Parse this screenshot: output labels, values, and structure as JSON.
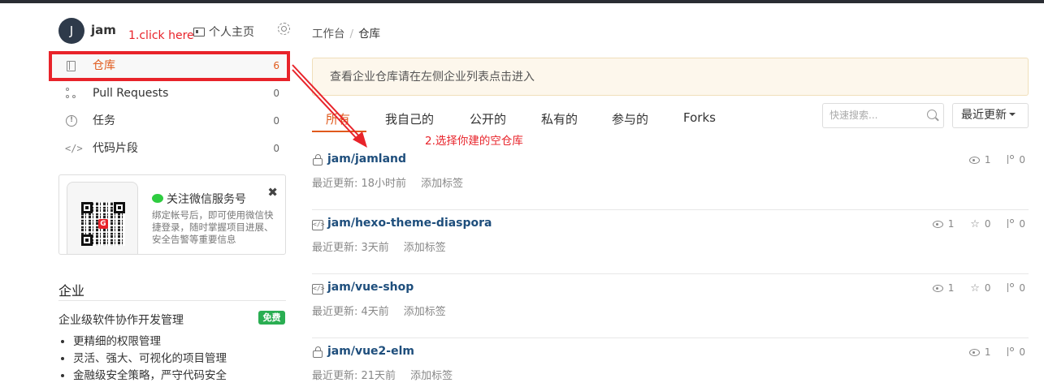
{
  "user": {
    "avatar_letter": "J",
    "name": "jam",
    "profile_link": "个人主页"
  },
  "annotations": {
    "step1": "1.click here",
    "step2": "2.选择你建的空仓库"
  },
  "nav": [
    {
      "label": "仓库",
      "count": "6",
      "icon": "book-icon",
      "active": true
    },
    {
      "label": "Pull Requests",
      "count": "0",
      "icon": "pull-request-icon"
    },
    {
      "label": "任务",
      "count": "0",
      "icon": "task-icon"
    },
    {
      "label": "代码片段",
      "count": "0",
      "icon": "code-snippet-icon"
    }
  ],
  "wechat": {
    "title": "关注微信服务号",
    "desc": "绑定帐号后，即可使用微信快捷登录，随时掌握项目进展、安全告警等重要信息",
    "close": "✖",
    "qr_logo": "G"
  },
  "enterprise": {
    "title": "企业",
    "subtitle": "企业级软件协作开发管理",
    "badge": "免费",
    "features": [
      "更精细的权限管理",
      "灵活、强大、可视化的项目管理",
      "金融级安全策略，严守代码安全"
    ]
  },
  "breadcrumb": {
    "root": "工作台",
    "sep": "/",
    "current": "仓库"
  },
  "notice": "查看企业仓库请在左侧企业列表点击进入",
  "tabs": [
    "所有",
    "我自己的",
    "公开的",
    "私有的",
    "参与的",
    "Forks"
  ],
  "active_tab": "所有",
  "search": {
    "placeholder": "快速搜索..."
  },
  "sort": {
    "label": "最近更新"
  },
  "repos": [
    {
      "name": "jam/jamland",
      "icon": "lock-icon",
      "updated": "最近更新: 18小时前",
      "tag_action": "添加标签",
      "watch": "1",
      "star": null,
      "fork": "0"
    },
    {
      "name": "jam/hexo-theme-diaspora",
      "icon": "code-repo-icon",
      "updated": "最近更新: 3天前",
      "tag_action": "添加标签",
      "watch": "1",
      "star": "0",
      "fork": "0"
    },
    {
      "name": "jam/vue-shop",
      "icon": "code-repo-icon",
      "updated": "最近更新: 4天前",
      "tag_action": "添加标签",
      "watch": "1",
      "star": "0",
      "fork": "0"
    },
    {
      "name": "jam/vue2-elm",
      "icon": "lock-icon",
      "updated": "最近更新: 21天前",
      "tag_action": "添加标签",
      "watch": "1",
      "star": null,
      "fork": "0"
    }
  ],
  "colors": {
    "accent": "#e05a1c",
    "annotation": "#e8232a",
    "repo_link": "#1e4e7c",
    "badge": "#2aae52"
  }
}
